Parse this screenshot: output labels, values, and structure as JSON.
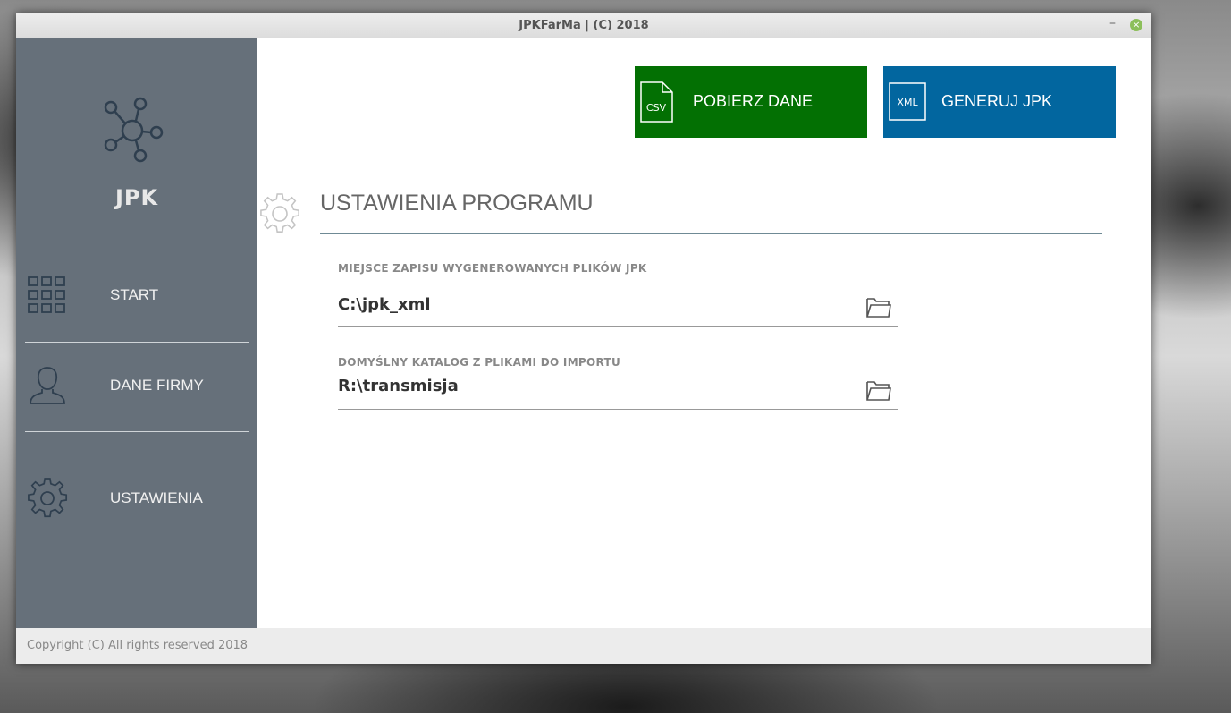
{
  "window": {
    "title": "JPKFarMa | (C) 2018"
  },
  "sidebar": {
    "logo_text": "JPK",
    "items": [
      {
        "label": "START",
        "icon": "grid-icon"
      },
      {
        "label": "DANE FIRMY",
        "icon": "user-icon"
      },
      {
        "label": "USTAWIENIA",
        "icon": "gear-icon"
      }
    ]
  },
  "toolbar": {
    "fetch": {
      "label": "POBIERZ DANE",
      "icon_text": "CSV",
      "color": "#037003"
    },
    "generate": {
      "label": "GENERUJ JPK",
      "icon_text": "XML",
      "color": "#02669f"
    }
  },
  "settings": {
    "title": "USTAWIENIA PROGRAMU",
    "fields": [
      {
        "label": "MIEJSCE ZAPISU WYGENEROWANYCH PLIKÓW JPK",
        "value": "C:\\jpk_xml"
      },
      {
        "label": "DOMYŚLNY KATALOG Z PLIKAMI DO IMPORTU",
        "value": "R:\\transmisja"
      }
    ]
  },
  "footer": {
    "copyright": "Copyright (C) All rights reserved 2018"
  }
}
